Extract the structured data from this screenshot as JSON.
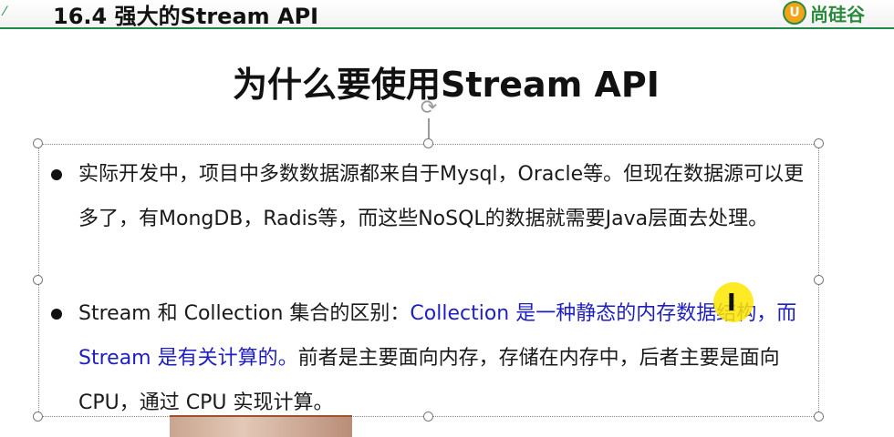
{
  "header": {
    "title": "16.4 强大的Stream API",
    "brand_text": "尚硅谷",
    "brand_logo_letter": "U"
  },
  "slide": {
    "title": "为什么要使用Stream API",
    "bullets": [
      {
        "text": "实际开发中，项目中多数数据源都来自于Mysql，Oracle等。但现在数据源可以更多了，有MongDB，Radis等，而这些NoSQL的数据就需要Java层面去处理。"
      },
      {
        "prefix": "Stream 和 Collection 集合的区别：",
        "highlight": "Collection 是一种静态的内存数据结构，而 Stream 是有关计算的。",
        "rest": "前者是主要面向内存，存储在内存中，后者主要是面向 CPU，通过 CPU 实现计算。"
      }
    ]
  },
  "colors": {
    "accent_green": "#1f8a4a",
    "highlight_blue": "#1f1fbf",
    "cursor_highlight": "#ffe600",
    "brand_orange": "#f2a417"
  },
  "icons": {
    "header_mark": "chevron-mark-icon",
    "rotate_handle": "rotate-icon",
    "cursor": "text-cursor-icon"
  }
}
